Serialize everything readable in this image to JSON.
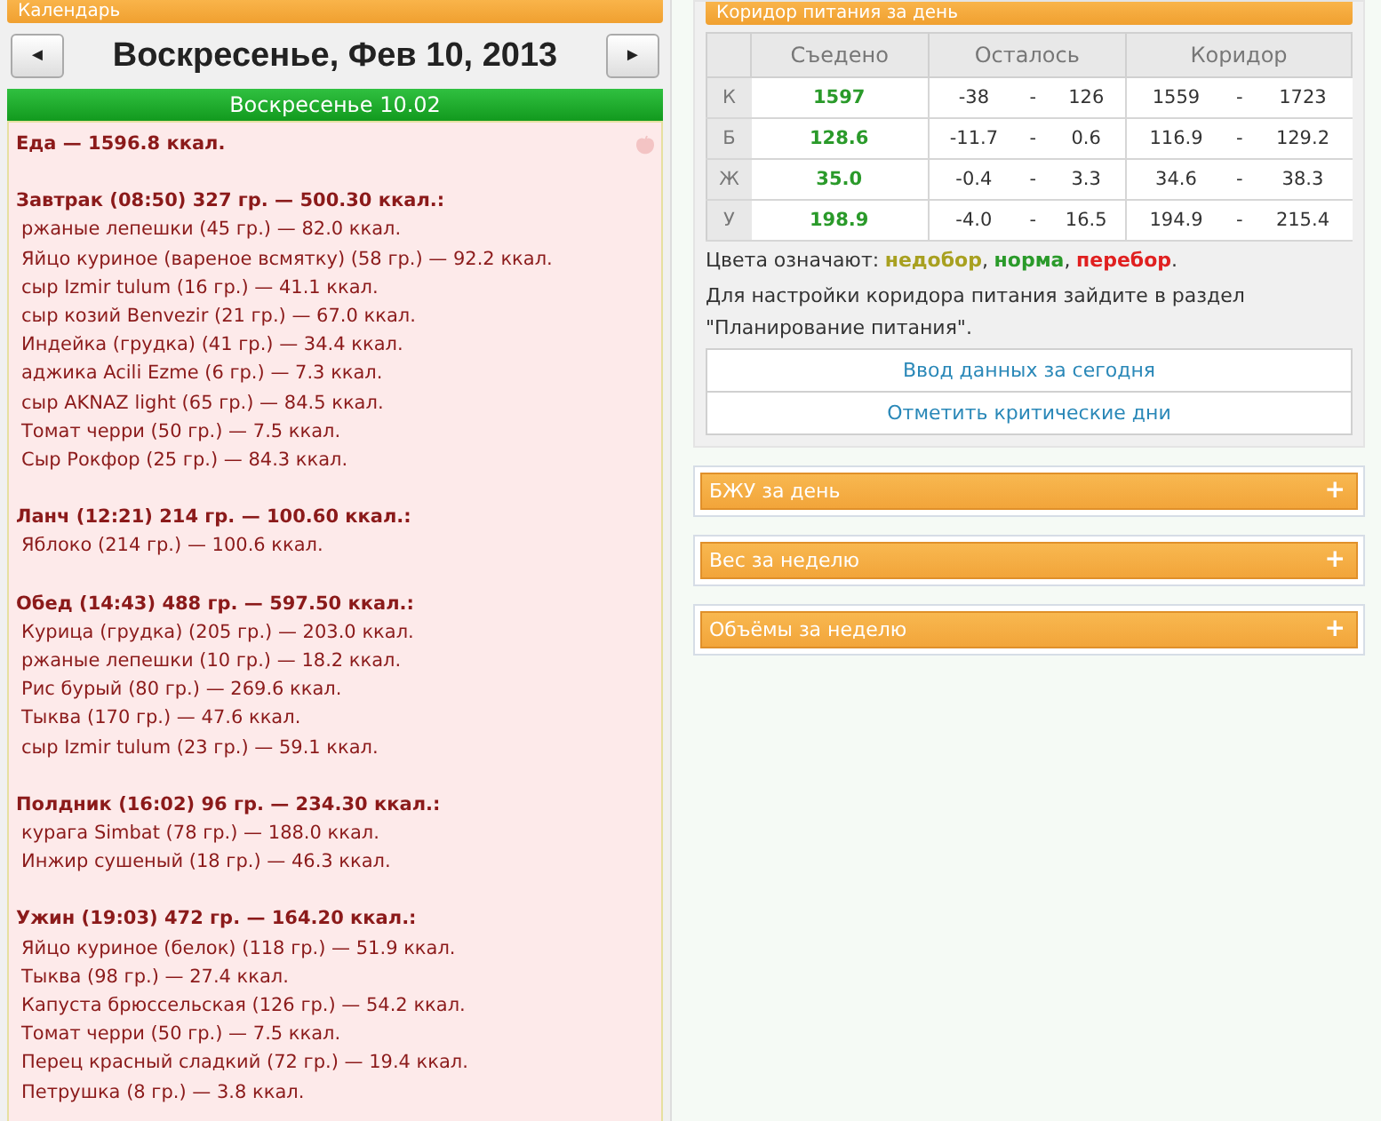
{
  "calendar": {
    "title": "Календарь",
    "prev": "◄",
    "next": "►",
    "date": "Воскресенье, Фев 10, 2013",
    "day_bar": "Воскресенье 10.02",
    "total": "Еда — 1596.8 ккал.",
    "meals": [
      {
        "title": "Завтрак (08:50) 327 гр. — 500.30 ккал.:",
        "items": [
          "ржаные лепешки (45 гр.) — 82.0 ккал.",
          "Яйцо куриное (вареное всмятку) (58 гр.) — 92.2 ккал.",
          "сыр Izmir tulum (16 гр.) — 41.1 ккал.",
          "сыр козий Benvezir (21 гр.) — 67.0 ккал.",
          "Индейка (грудка) (41 гр.) — 34.4 ккал.",
          "аджика Acili Ezme (6 гр.) — 7.3 ккал.",
          "сыр AKNAZ light (65 гр.) — 84.5 ккал.",
          "Томат черри (50 гр.) — 7.5 ккал.",
          "Сыр Рокфор (25 гр.) — 84.3 ккал."
        ]
      },
      {
        "title": "Ланч (12:21) 214 гр. — 100.60 ккал.:",
        "items": [
          "Яблоко (214 гр.) — 100.6 ккал."
        ]
      },
      {
        "title": "Обед (14:43) 488 гр. — 597.50 ккал.:",
        "items": [
          "Курица (грудка) (205 гр.) — 203.0 ккал.",
          "ржаные лепешки (10 гр.) — 18.2 ккал.",
          "Рис бурый (80 гр.) — 269.6 ккал.",
          "Тыква (170 гр.) — 47.6 ккал.",
          "сыр Izmir tulum (23 гр.) — 59.1 ккал."
        ]
      },
      {
        "title": "Полдник (16:02) 96 гр. — 234.30 ккал.:",
        "items": [
          "курага Simbat (78 гр.) — 188.0 ккал.",
          "Инжир сушеный (18 гр.) — 46.3 ккал."
        ]
      },
      {
        "title": "Ужин (19:03) 472 гр. — 164.20 ккал.:",
        "items": [
          "Яйцо куриное (белок) (118 гр.) — 51.9 ккал.",
          "Тыква (98 гр.) — 27.4 ккал.",
          "Капуста брюссельская (126 гр.) — 54.2 ккал.",
          "Томат черри (50 гр.) — 7.5 ккал.",
          "Перец красный сладкий (72 гр.) — 19.4 ккал.",
          "Петрушка (8 гр.) — 3.8 ккал."
        ]
      }
    ]
  },
  "corridor": {
    "title": "Коридор питания за день",
    "columns": [
      "Съедено",
      "Осталось",
      "Коридор"
    ],
    "rows": [
      {
        "label": "К",
        "eaten": "1597",
        "color": "#2a9a2a",
        "left_min": "-38",
        "left_max": "126",
        "range_min": "1559",
        "range_max": "1723"
      },
      {
        "label": "Б",
        "eaten": "128.6",
        "color": "#2a9a2a",
        "left_min": "-11.7",
        "left_max": "0.6",
        "range_min": "116.9",
        "range_max": "129.2"
      },
      {
        "label": "Ж",
        "eaten": "35.0",
        "color": "#2a9a2a",
        "left_min": "-0.4",
        "left_max": "3.3",
        "range_min": "34.6",
        "range_max": "38.3"
      },
      {
        "label": "У",
        "eaten": "198.9",
        "color": "#2a9a2a",
        "left_min": "-4.0",
        "left_max": "16.5",
        "range_min": "194.9",
        "range_max": "215.4"
      }
    ],
    "dash": "-",
    "legend": {
      "label": "Цвета означают:",
      "items": [
        {
          "text": "недобор",
          "color": "#a8a020",
          "after": ","
        },
        {
          "text": "норма",
          "color": "#2a9a2a",
          "after": ","
        },
        {
          "text": "перебор",
          "color": "#e02020",
          "after": "."
        }
      ]
    },
    "note": "Для настройки коридора питания зайдите в раздел \"Планирование питания\".",
    "buttons": [
      "Ввод данных за сегодня",
      "Отметить критические дни"
    ]
  },
  "panels": [
    {
      "title": "БЖУ за день",
      "toggle": "+"
    },
    {
      "title": "Вес за неделю",
      "toggle": "+"
    },
    {
      "title": "Объёмы за неделю",
      "toggle": "+"
    }
  ]
}
